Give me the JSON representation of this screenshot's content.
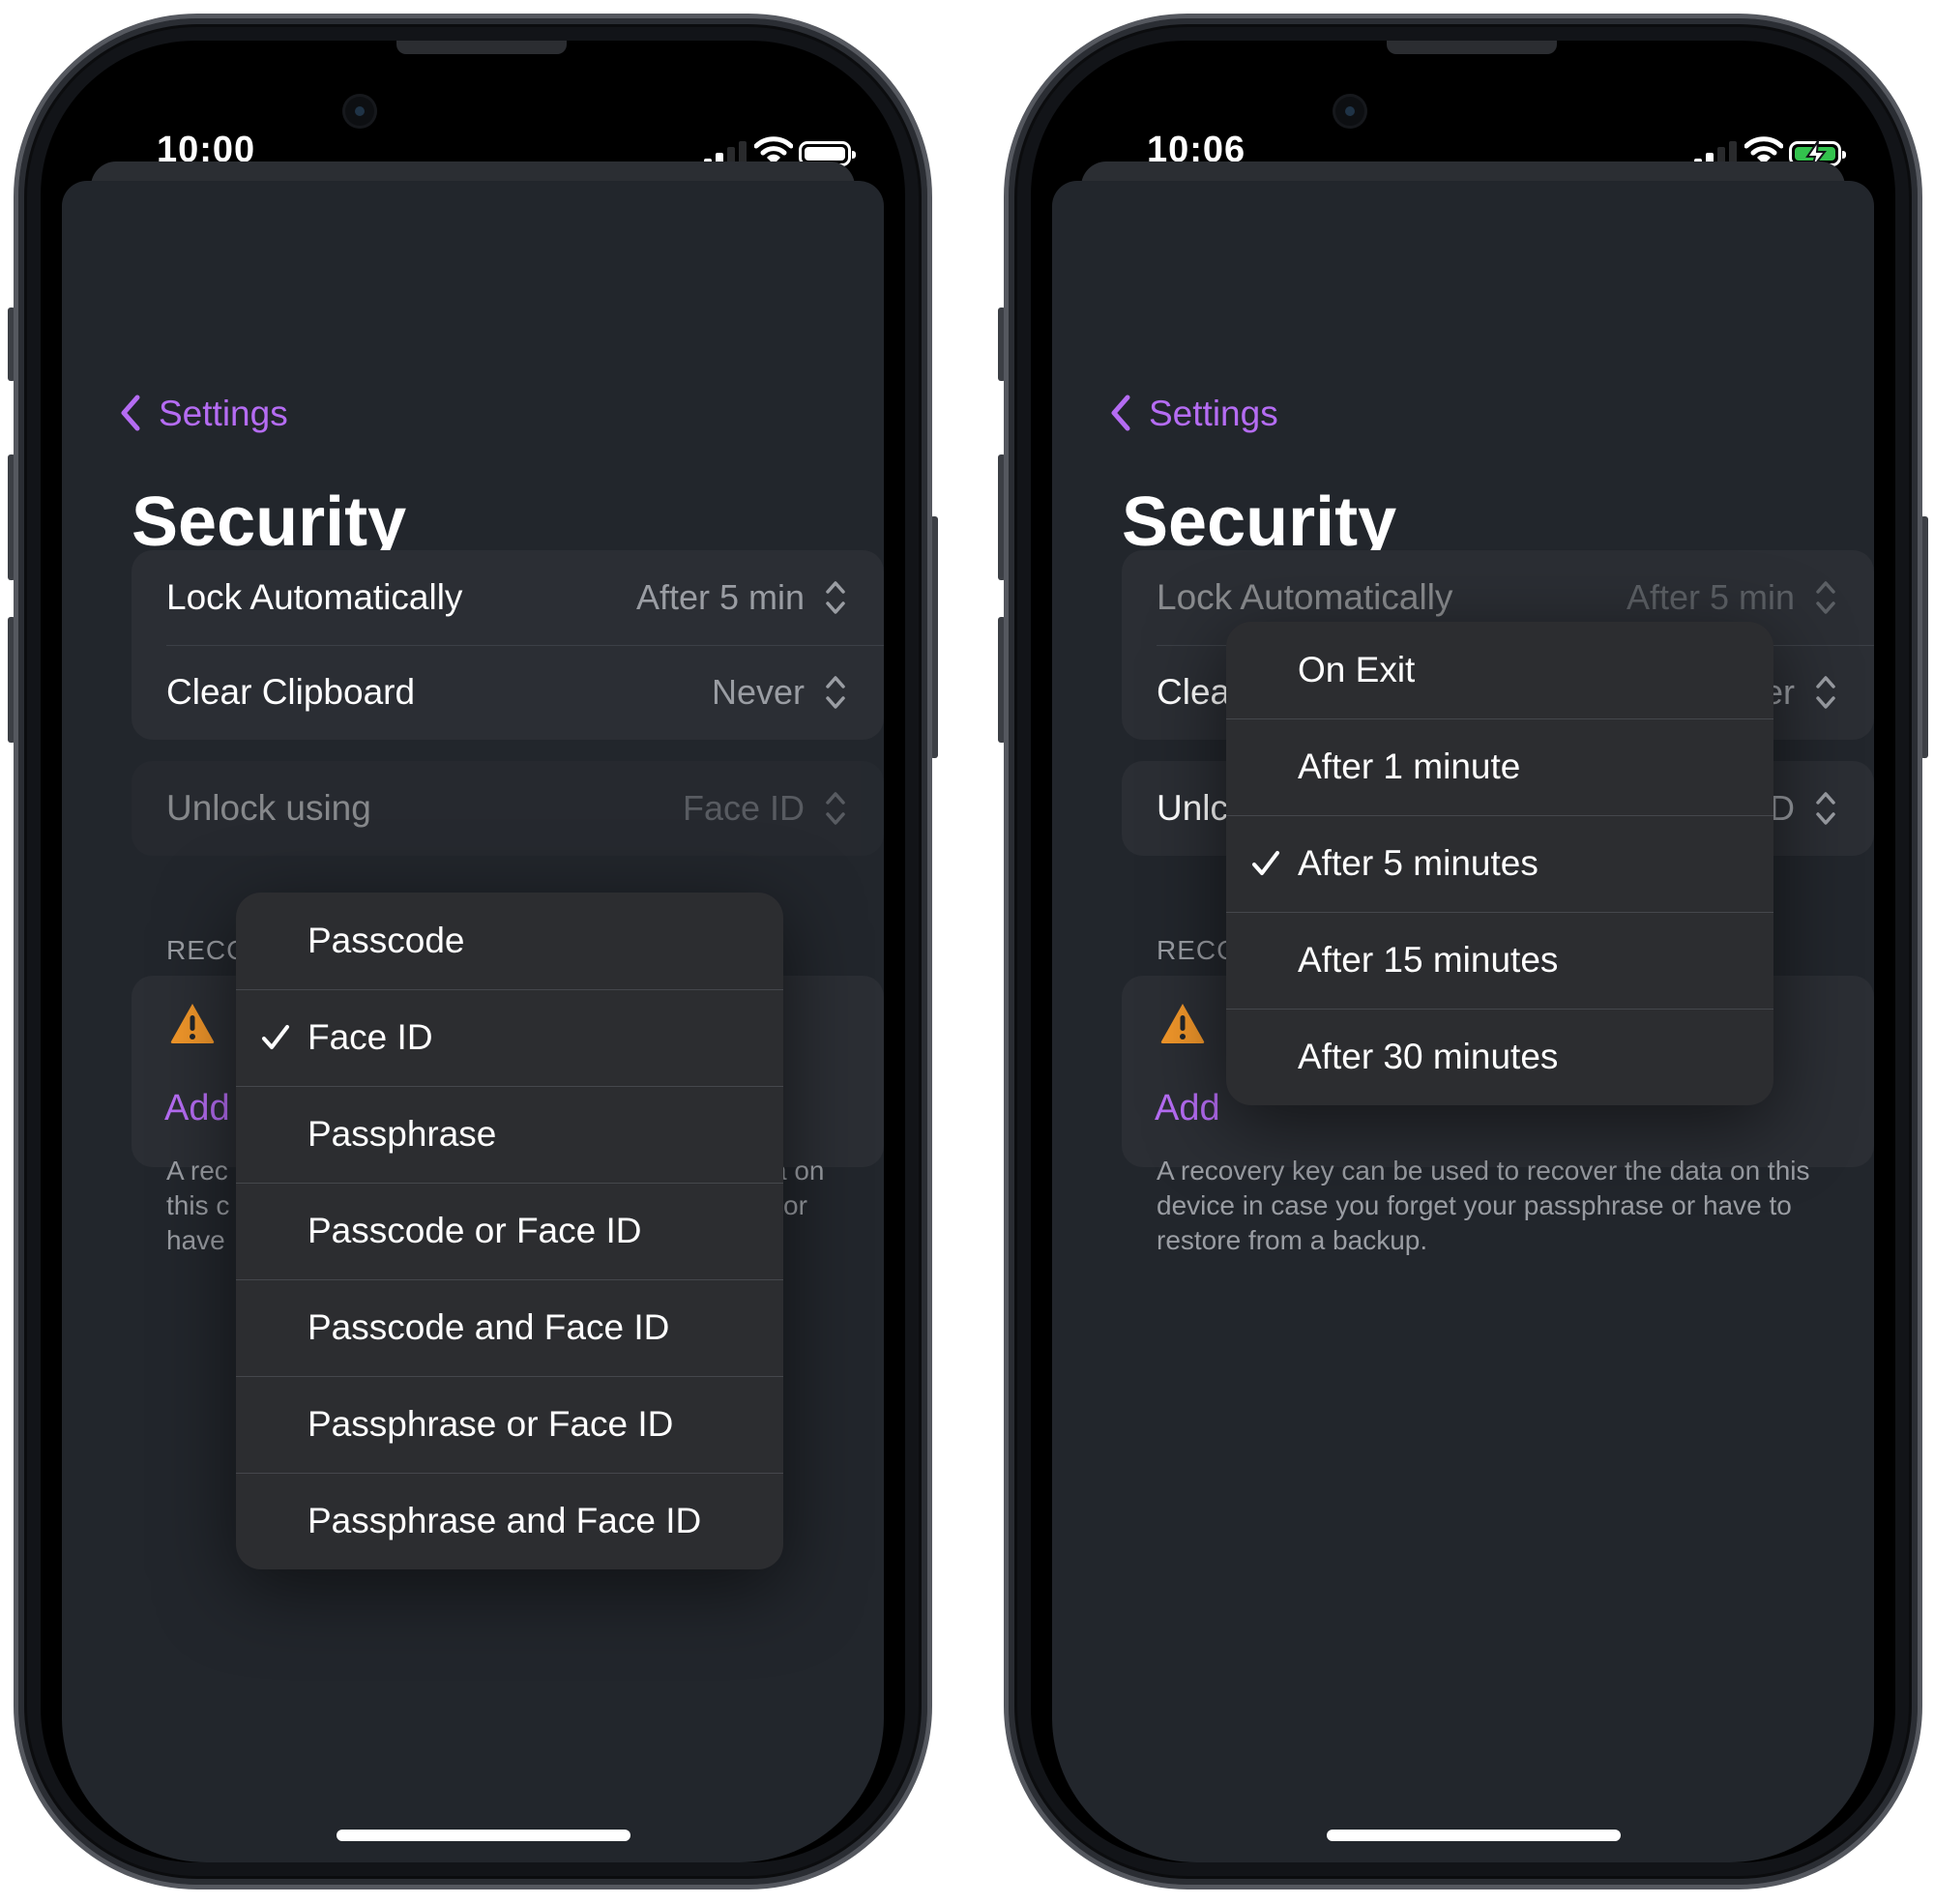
{
  "phones": [
    {
      "status_bar": {
        "time": "10:00",
        "signal_bars": 2,
        "battery": "full"
      },
      "nav": {
        "back_label": "Settings",
        "title": "Security"
      },
      "settings_rows": [
        {
          "label": "Lock Automatically",
          "value": "After 5 min"
        },
        {
          "label": "Clear Clipboard",
          "value": "Never"
        }
      ],
      "unlock_row": {
        "label": "Unlock using",
        "value": "Face ID"
      },
      "recovery": {
        "header_visible": "RECC",
        "add_visible": "Add",
        "footer_visible": [
          "A rec",
          "a on",
          "this c",
          "or",
          "have"
        ]
      },
      "menu": {
        "items": [
          "Passcode",
          "Face ID",
          "Passphrase",
          "Passcode or Face ID",
          "Passcode and Face ID",
          "Passphrase or Face ID",
          "Passphrase and Face ID"
        ],
        "selected_index": 1
      }
    },
    {
      "status_bar": {
        "time": "10:06",
        "signal_bars": 2,
        "battery": "charging"
      },
      "nav": {
        "back_label": "Settings",
        "title": "Security"
      },
      "settings_rows": [
        {
          "label": "Lock Automatically",
          "value": "After 5 min"
        },
        {
          "label_visible": "Clea",
          "value_visible": "er"
        }
      ],
      "unlock_row": {
        "label_visible": "Unlc",
        "value_visible": "D"
      },
      "recovery": {
        "header_visible": "RECC",
        "add_label": "Add",
        "footer": "A recovery key can be used to recover the data on this device in case you forget your passphrase or have to restore from a backup."
      },
      "menu": {
        "items": [
          "On Exit",
          "After 1 minute",
          "After 5 minutes",
          "After 15 minutes",
          "After 30 minutes"
        ],
        "selected_index": 2
      }
    }
  ],
  "colors": {
    "accent": "#b56cf3",
    "sheet_background": "#22262c",
    "card_background": "#2b2e34",
    "menu_background": "#2c2d30",
    "secondary_text": "#9a9da3",
    "warning": "#f0962a",
    "charging": "#33c24d"
  },
  "icons": [
    "chevron-left-icon",
    "up-down-chevron-icon",
    "checkmark-icon",
    "warning-triangle-icon",
    "wifi-icon",
    "cellular-signal-icon",
    "battery-icon",
    "charging-bolt-icon"
  ]
}
